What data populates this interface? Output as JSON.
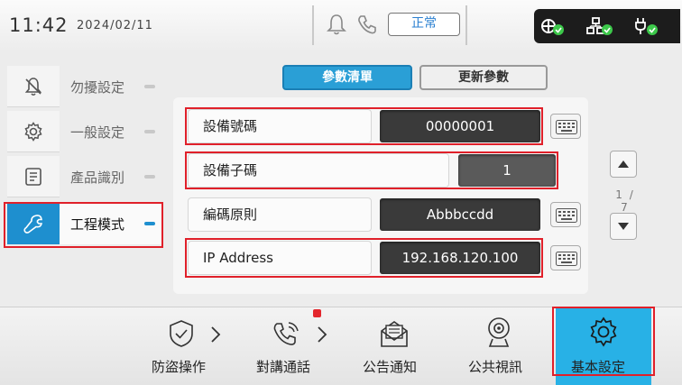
{
  "status_bar": {
    "time": "11:42",
    "date": "2024/02/11",
    "status_label": "正常",
    "icons": [
      "bell-icon",
      "phone-icon",
      "network-ok-icon",
      "lan-ok-icon",
      "power-ok-icon"
    ]
  },
  "sidebar": {
    "items": [
      {
        "label": "勿擾設定",
        "icon": "do-not-disturb-icon",
        "active": false
      },
      {
        "label": "一般設定",
        "icon": "gear-icon",
        "active": false
      },
      {
        "label": "產品識別",
        "icon": "id-card-icon",
        "active": false
      },
      {
        "label": "工程模式",
        "icon": "wrench-icon",
        "active": true
      }
    ]
  },
  "tabs": {
    "params": "參數清單",
    "update": "更新參數"
  },
  "form": {
    "rows": [
      {
        "label": "設備號碼",
        "value": "00000001",
        "has_keyboard": true
      },
      {
        "label": "設備子碼",
        "value": "1",
        "has_keyboard": false
      },
      {
        "label": "編碼原則",
        "value": "Abbbccdd",
        "has_keyboard": true
      },
      {
        "label": "IP Address",
        "value": "192.168.120.100",
        "has_keyboard": true
      }
    ],
    "page_indicator": "1 / 7"
  },
  "bottom_nav": {
    "items": [
      {
        "label": "防盜操作",
        "icon": "shield-check-icon",
        "active": false
      },
      {
        "label": "對講通話",
        "icon": "intercom-call-icon",
        "active": false,
        "badge": true
      },
      {
        "label": "公告通知",
        "icon": "mail-notice-icon",
        "active": false
      },
      {
        "label": "公共視訊",
        "icon": "webcam-icon",
        "active": false
      },
      {
        "label": "基本設定",
        "icon": "gear-icon",
        "active": true
      }
    ]
  },
  "colors": {
    "accent": "#2a9fd6",
    "active_nav": "#28b1e6",
    "highlight_box": "#e0202a",
    "ok_green": "#3cc84a"
  }
}
